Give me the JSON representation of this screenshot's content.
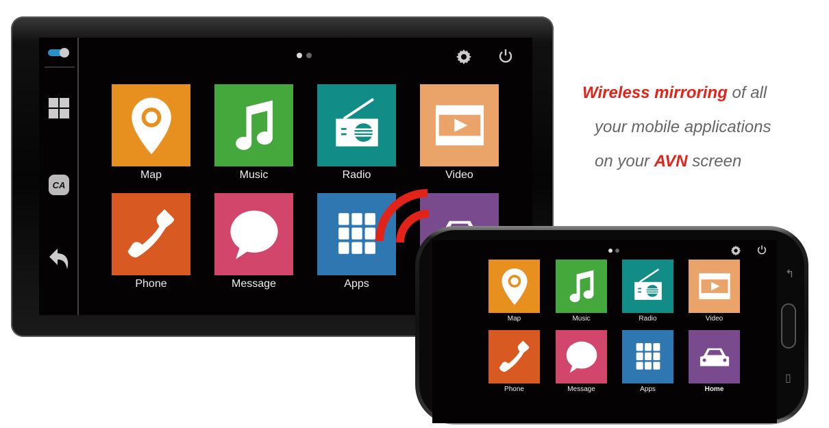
{
  "apps": [
    {
      "label": "Map",
      "icon": "map-pin-icon",
      "color": "#e8901f"
    },
    {
      "label": "Music",
      "icon": "music-note-icon",
      "color": "#45a83c"
    },
    {
      "label": "Radio",
      "icon": "radio-icon",
      "color": "#128c86"
    },
    {
      "label": "Video",
      "icon": "video-film-icon",
      "color": "#eaa46a"
    },
    {
      "label": "Phone",
      "icon": "phone-icon",
      "color": "#d85a22"
    },
    {
      "label": "Message",
      "icon": "message-bubble-icon",
      "color": "#d2466c"
    },
    {
      "label": "Apps",
      "icon": "apps-grid-icon",
      "color": "#2f77b0"
    },
    {
      "label": "Home",
      "icon": "car-icon",
      "color": "#7a4a8e"
    }
  ],
  "sidebar": {
    "items": [
      "toggle-icon",
      "grid-icon",
      "ca-logo-icon",
      "back-arrow-icon"
    ]
  },
  "page_indicator": {
    "pages": 2,
    "current": 1
  },
  "tagline": {
    "line1_highlight": "Wireless mirroring",
    "line1_rest": " of all",
    "line2": "your mobile applications",
    "line3_pre": "on your ",
    "line3_highlight": "AVN",
    "line3_post": " screen"
  },
  "colors": {
    "accent": "#e2231a",
    "screen_bg": "#050203"
  }
}
